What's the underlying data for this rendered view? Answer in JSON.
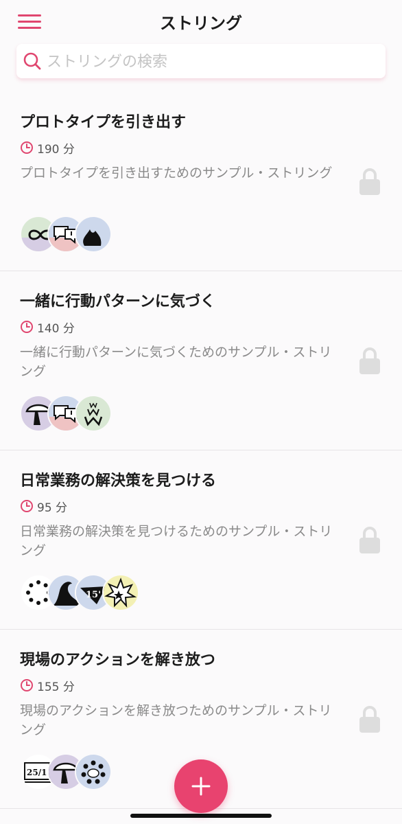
{
  "header": {
    "title": "ストリング",
    "menu_icon": "hamburger-menu-icon"
  },
  "search": {
    "placeholder": "ストリングの検索",
    "value": "",
    "icon": "search-icon"
  },
  "colors": {
    "accent": "#e0466f",
    "fab": "#e8436f",
    "background": "#fbfafb",
    "secondary_text": "#8a8a8a",
    "lock": "#dddddd"
  },
  "strings": [
    {
      "title": "プロトタイプを引き出す",
      "duration": "190 分",
      "description": "プロトタイプを引き出すためのサンプル・ストリング",
      "locked": true,
      "avatars": [
        "infinity-loop-avatar",
        "speech-bubbles-avatar",
        "flame-avatar"
      ]
    },
    {
      "title": "一緒に行動パターンに気づく",
      "duration": "140 分",
      "description": "一緒に行動パターンに気づくためのサンプル・ストリング",
      "locked": true,
      "avatars": [
        "mushroom-avatar",
        "speech-bubbles-avatar",
        "www-avatar"
      ]
    },
    {
      "title": "日常業務の解決策を見つける",
      "duration": "95 分",
      "description": "日常業務の解決策を見つけるためのサンプル・ストリング",
      "locked": true,
      "avatars": [
        "dotted-circle-avatar",
        "wave-avatar",
        "fifteen-minutes-avatar",
        "star-explosion-avatar"
      ]
    },
    {
      "title": "現場のアクションを解き放つ",
      "duration": "155 分",
      "description": "現場のアクションを解き放つためのサンプル・ストリング",
      "locked": true,
      "avatars": [
        "calendar-25-avatar",
        "mushroom-avatar",
        "people-circle-avatar"
      ],
      "avatar_texts": {
        "calendar-25-avatar": "25/1"
      }
    }
  ],
  "fab": {
    "icon": "plus-icon"
  }
}
